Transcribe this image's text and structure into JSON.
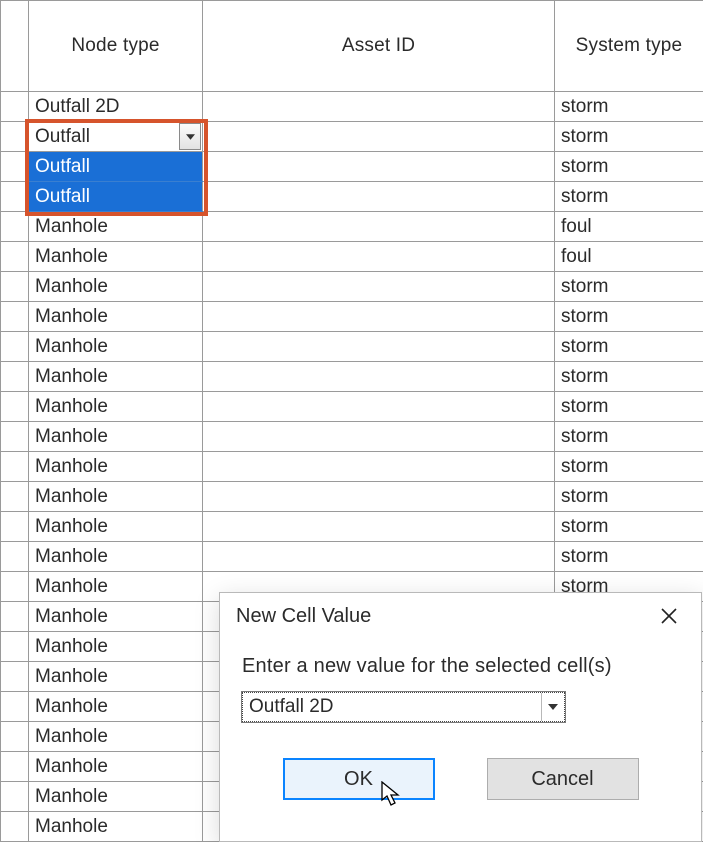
{
  "columns": {
    "node_type": "Node type",
    "asset_id": "Asset ID",
    "system_type": "System type"
  },
  "rows": [
    {
      "node_type": "Outfall 2D",
      "asset_id": "",
      "system_type": "storm",
      "state": "plain"
    },
    {
      "node_type": "Outfall",
      "asset_id": "",
      "system_type": "storm",
      "state": "active"
    },
    {
      "node_type": "Outfall",
      "asset_id": "",
      "system_type": "storm",
      "state": "selected"
    },
    {
      "node_type": "Outfall",
      "asset_id": "",
      "system_type": "storm",
      "state": "selected"
    },
    {
      "node_type": "Manhole",
      "asset_id": "",
      "system_type": "foul",
      "state": "plain"
    },
    {
      "node_type": "Manhole",
      "asset_id": "",
      "system_type": "foul",
      "state": "plain"
    },
    {
      "node_type": "Manhole",
      "asset_id": "",
      "system_type": "storm",
      "state": "plain"
    },
    {
      "node_type": "Manhole",
      "asset_id": "",
      "system_type": "storm",
      "state": "plain"
    },
    {
      "node_type": "Manhole",
      "asset_id": "",
      "system_type": "storm",
      "state": "plain"
    },
    {
      "node_type": "Manhole",
      "asset_id": "",
      "system_type": "storm",
      "state": "plain"
    },
    {
      "node_type": "Manhole",
      "asset_id": "",
      "system_type": "storm",
      "state": "plain"
    },
    {
      "node_type": "Manhole",
      "asset_id": "",
      "system_type": "storm",
      "state": "plain"
    },
    {
      "node_type": "Manhole",
      "asset_id": "",
      "system_type": "storm",
      "state": "plain"
    },
    {
      "node_type": "Manhole",
      "asset_id": "",
      "system_type": "storm",
      "state": "plain"
    },
    {
      "node_type": "Manhole",
      "asset_id": "",
      "system_type": "storm",
      "state": "plain"
    },
    {
      "node_type": "Manhole",
      "asset_id": "",
      "system_type": "storm",
      "state": "plain"
    },
    {
      "node_type": "Manhole",
      "asset_id": "",
      "system_type": "storm",
      "state": "plain"
    },
    {
      "node_type": "Manhole",
      "asset_id": "",
      "system_type": "",
      "state": "plain"
    },
    {
      "node_type": "Manhole",
      "asset_id": "",
      "system_type": "",
      "state": "plain"
    },
    {
      "node_type": "Manhole",
      "asset_id": "",
      "system_type": "",
      "state": "plain"
    },
    {
      "node_type": "Manhole",
      "asset_id": "",
      "system_type": "",
      "state": "plain"
    },
    {
      "node_type": "Manhole",
      "asset_id": "",
      "system_type": "",
      "state": "plain"
    },
    {
      "node_type": "Manhole",
      "asset_id": "",
      "system_type": "",
      "state": "plain"
    },
    {
      "node_type": "Manhole",
      "asset_id": "",
      "system_type": "",
      "state": "plain"
    },
    {
      "node_type": "Manhole",
      "asset_id": "",
      "system_type": "",
      "state": "plain"
    }
  ],
  "dialog": {
    "title": "New Cell Value",
    "prompt": "Enter a new value for the selected cell(s)",
    "value": "Outfall 2D",
    "ok": "OK",
    "cancel": "Cancel"
  },
  "colors": {
    "highlight_border": "#d6542c",
    "selection_bg": "#1a6fd6",
    "primary_btn_border": "#0a84ff"
  }
}
